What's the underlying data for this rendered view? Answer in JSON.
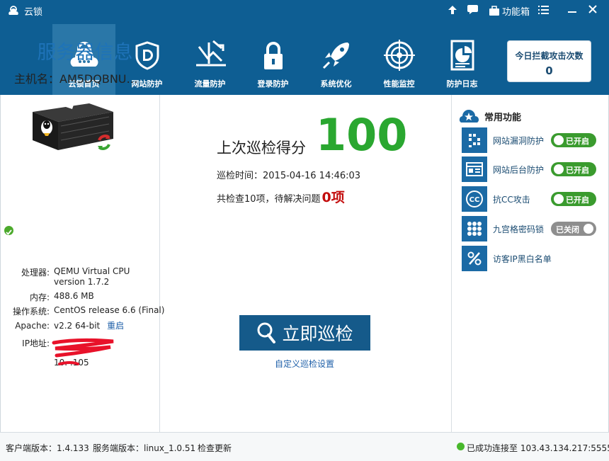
{
  "titlebar": {
    "app_name": "云锁",
    "toolbox_label": "功能箱"
  },
  "nav": {
    "items": [
      {
        "label": "云锁首页",
        "icon": "cloud-lock-icon"
      },
      {
        "label": "网站防护",
        "icon": "shield-d-icon"
      },
      {
        "label": "流量防护",
        "icon": "traffic-chart-icon"
      },
      {
        "label": "登录防护",
        "icon": "padlock-icon"
      },
      {
        "label": "系统优化",
        "icon": "rocket-icon"
      },
      {
        "label": "性能监控",
        "icon": "radar-icon"
      },
      {
        "label": "防护日志",
        "icon": "log-report-icon"
      }
    ],
    "active_index": 0
  },
  "attack_counter": {
    "label": "今日拦截攻击次数",
    "value": "0"
  },
  "server": {
    "title": "服务器信息",
    "hostname": "主机名：AM5DQBNU…",
    "specs": [
      {
        "key": "处理器:",
        "value": "QEMU Virtual CPU version 1.7.2"
      },
      {
        "key": "内存:",
        "value": "488.6 MB"
      },
      {
        "key": "操作系统:",
        "value": "CentOS release 6.6 (Final)"
      },
      {
        "key": "Apache:",
        "value": "v2.2 64-bit"
      },
      {
        "key": "IP地址:",
        "value": "10.  .105"
      }
    ],
    "restart_label": "重启"
  },
  "scan": {
    "score_label": "上次巡检得分",
    "score": "100",
    "time": "巡检时间：2015-04-16 14:46:03",
    "summary": "共检查10项，待解决问题",
    "issues": "0项",
    "button_label": "立即巡检",
    "custom_label": "自定义巡检设置"
  },
  "common_functions": {
    "title": "常用功能",
    "items": [
      {
        "label": "网站漏洞防护",
        "icon": "vulnerability-icon",
        "toggle": "已开启",
        "state": "on"
      },
      {
        "label": "网站后台防护",
        "icon": "admin-panel-icon",
        "toggle": "已开启",
        "state": "on"
      },
      {
        "label": "抗CC攻击",
        "icon": "cc-icon",
        "toggle": "已开启",
        "state": "on"
      },
      {
        "label": "九宫格密码锁",
        "icon": "grid-lock-icon",
        "toggle": "已关闭",
        "state": "off"
      },
      {
        "label": "访客IP黑白名单",
        "icon": "percent-list-icon",
        "toggle": "",
        "state": "none"
      }
    ]
  },
  "statusbar": {
    "client_version": "客户端版本：1.4.133",
    "server_version": "服务端版本：linux_1.0.51",
    "check_update": "检查更新",
    "connection": "已成功连接至 103.43.134.217:5555"
  },
  "colors": {
    "header_bg": "#0e5e93",
    "score_green": "#2aa730",
    "issue_red": "#c30d0d",
    "toggle_on": "#3a9b2e",
    "toggle_off": "#8e8e8e"
  }
}
